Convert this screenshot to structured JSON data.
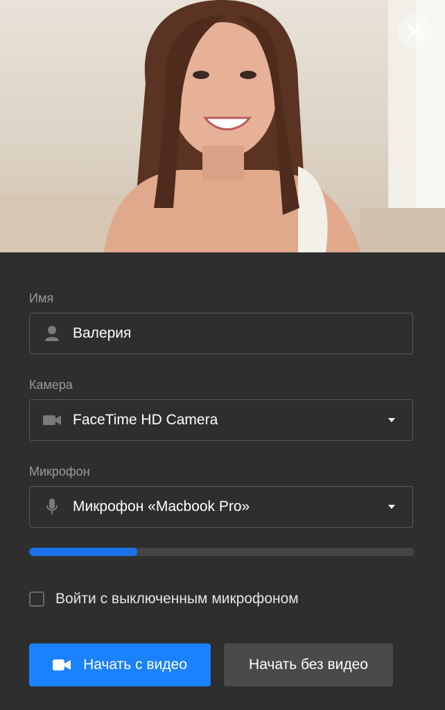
{
  "preview": {
    "description_icon": "camera-preview-image",
    "close_icon": "close-icon"
  },
  "form": {
    "name_label": "Имя",
    "name_value": "Валерия",
    "camera_label": "Камера",
    "camera_value": "FaceTime HD Camera",
    "mic_label": "Микрофон",
    "mic_value": "Микрофон «Macbook Pro»",
    "mic_level": 0.28,
    "mute_checkbox_label": "Войти с выключенным микрофоном",
    "mute_checked": false
  },
  "buttons": {
    "start_video": "Начать с видео",
    "start_no_video": "Начать без видео"
  },
  "colors": {
    "accent": "#1a82ff",
    "panel_bg": "#2e2e2e",
    "meter_fill": "#1a73e8"
  }
}
